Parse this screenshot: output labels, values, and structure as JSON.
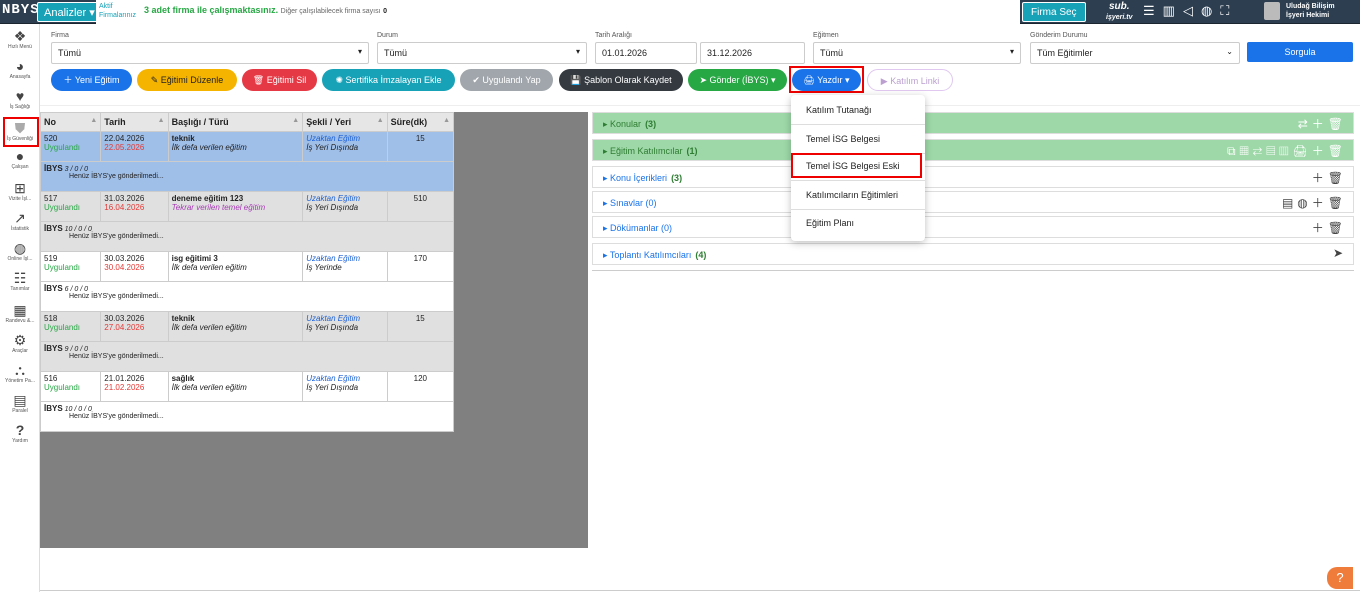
{
  "topbar": {
    "logo": "NBYS",
    "analizler": "Analizler",
    "aktif_line1": "Aktif",
    "aktif_line2": "Firmalarınız",
    "firm_msg": "3 adet firma ile çalışmaktasınız.",
    "firm_sub": "Diğer çalışılabilecek firma sayısı",
    "firm_sub_count": "0",
    "firma_sec": "Firma Seç",
    "sub_line1": "sub.",
    "sub_line2": "işyeri.tv",
    "user_line1": "Uludağ Bilişim",
    "user_line2": "İşyeri Hekimi"
  },
  "sidebar": [
    {
      "label": "Hızlı Menü",
      "icon": "cubes-icon"
    },
    {
      "label": "Anasayfa",
      "icon": "pie-chart-icon"
    },
    {
      "label": "İş Sağlığı",
      "icon": "heartbeat-icon"
    },
    {
      "label": "İş Güvenliği",
      "icon": "shield-icon"
    },
    {
      "label": "Çalışan",
      "icon": "user-icon"
    },
    {
      "label": "Vizite İşl...",
      "icon": "medkit-icon"
    },
    {
      "label": "İstatistik",
      "icon": "line-chart-icon"
    },
    {
      "label": "Online İşl...",
      "icon": "globe-icon"
    },
    {
      "label": "Tanımlar",
      "icon": "sliders-icon"
    },
    {
      "label": "Randevu &...",
      "icon": "calendar-icon"
    },
    {
      "label": "Araçlar",
      "icon": "cogs-icon"
    },
    {
      "label": "Yönetim Pa...",
      "icon": "sitemap-icon"
    },
    {
      "label": "Paralel",
      "icon": "server-icon"
    },
    {
      "label": "Yardım",
      "icon": "question-icon"
    }
  ],
  "filters": {
    "firma_label": "Firma",
    "firma_value": "Tümü",
    "durum_label": "Durum",
    "durum_value": "Tümü",
    "tarih_label": "Tarih Aralığı",
    "tarih_start": "01.01.2026",
    "tarih_end": "31.12.2026",
    "egitmen_label": "Eğitmen",
    "egitmen_value": "Tümü",
    "gonderim_label": "Gönderim Durumu",
    "gonderim_value": "Tüm Eğitimler",
    "sorgula": "Sorgula"
  },
  "toolbar": [
    {
      "label": "Yeni Eğitim",
      "color": "#1a73e8"
    },
    {
      "label": "Eğitimi Düzenle",
      "color": "#f5b400"
    },
    {
      "label": "Eğitimi Sil",
      "color": "#e53945"
    },
    {
      "label": "Sertifika İmzalayan Ekle",
      "color": "#17a2b8"
    },
    {
      "label": "Uygulandı Yap",
      "color": "#a0a6ab"
    },
    {
      "label": "Şablon Olarak Kaydet",
      "color": "#343a40"
    },
    {
      "label": "Gönder (İBYS)",
      "color": "#28a745"
    },
    {
      "label": "Yazdır",
      "color": "#1a73e8"
    },
    {
      "label": "Katılım Linki",
      "color": "#e8d9f5"
    }
  ],
  "table": {
    "headers": [
      "No",
      "Tarih",
      "Başlığı / Türü",
      "Şekli / Yeri",
      "Süre(dk)"
    ],
    "rows": [
      {
        "no": "520",
        "status": "Uygulandı",
        "date1": "22.04.2026",
        "date2": "22.05.2026",
        "title": "teknik",
        "type": "İlk defa verilen eğitim",
        "sekil": "Uzaktan Eğitim",
        "yer": "İş Yeri Dışında",
        "sure": "15",
        "ibys_counts": "3 / 0 / 0",
        "ibys_msg": "Henüz İBYS'ye gönderilmedi..."
      },
      {
        "no": "517",
        "status": "Uygulandı",
        "date1": "31.03.2026",
        "date2": "16.04.2026",
        "title": "deneme eğitim 123",
        "type": "Tekrar verilen temel eğitim",
        "sekil": "Uzaktan Eğitim",
        "yer": "İş Yeri Dışında",
        "sure": "510",
        "ibys_counts": "10 / 0 / 0",
        "ibys_msg": "Henüz İBYS'ye gönderilmedi..."
      },
      {
        "no": "519",
        "status": "Uygulandı",
        "date1": "30.03.2026",
        "date2": "30.04.2026",
        "title": "isg eğitimi 3",
        "type": "İlk defa verilen eğitim",
        "sekil": "Uzaktan Eğitim",
        "yer": "İş Yerinde",
        "sure": "170",
        "ibys_counts": "6 / 0 / 0",
        "ibys_msg": "Henüz İBYS'ye gönderilmedi..."
      },
      {
        "no": "518",
        "status": "Uygulandı",
        "date1": "30.03.2026",
        "date2": "27.04.2026",
        "title": "teknik",
        "type": "İlk defa verilen eğitim",
        "sekil": "Uzaktan Eğitim",
        "yer": "İş Yeri Dışında",
        "sure": "15",
        "ibys_counts": "9 / 0 / 0",
        "ibys_msg": "Henüz İBYS'ye gönderilmedi..."
      },
      {
        "no": "516",
        "status": "Uygulandı",
        "date1": "21.01.2026",
        "date2": "21.02.2026",
        "title": "sağlık",
        "type": "İlk defa verilen eğitim",
        "sekil": "Uzaktan Eğitim",
        "yer": "İş Yeri Dışında",
        "sure": "120",
        "ibys_counts": "10 / 0 / 0",
        "ibys_msg": "Henüz İBYS'ye gönderilmedi..."
      }
    ],
    "ibys_label": "İBYS"
  },
  "panels": [
    {
      "label": "Konular",
      "count": "(3)"
    },
    {
      "label": "Eğitim Katılımcılar",
      "count": "(1)"
    },
    {
      "label": "Konu İçerikleri",
      "count": "(3)"
    },
    {
      "label": "Sınavlar (0)",
      "count": ""
    },
    {
      "label": "Dökümanlar (0)",
      "count": ""
    },
    {
      "label": "Toplantı Katılımcıları",
      "count": "(4)"
    }
  ],
  "dropdown": [
    "Katılım Tutanağı",
    "Temel İSG Belgesi",
    "Temel İSG Belgesi Eski",
    "Katılımcıların Eğitimleri",
    "Eğitim Planı"
  ],
  "help": "?"
}
